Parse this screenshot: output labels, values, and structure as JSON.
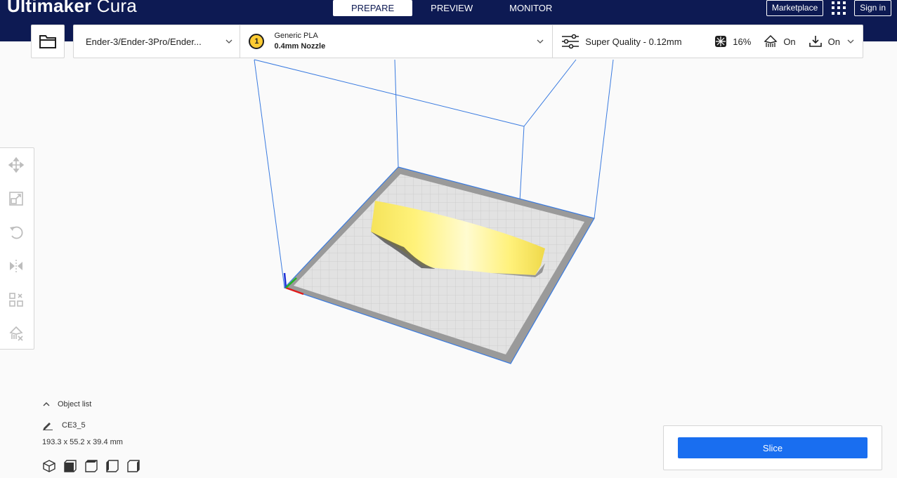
{
  "app": {
    "brand_bold": "Ultimaker",
    "brand_light": "Cura"
  },
  "stages": [
    {
      "label": "PREPARE",
      "active": true
    },
    {
      "label": "PREVIEW",
      "active": false
    },
    {
      "label": "MONITOR",
      "active": false
    }
  ],
  "header": {
    "marketplace": "Marketplace",
    "sign_in": "Sign in"
  },
  "machine": {
    "name": "Ender-3/Ender-3Pro/Ender..."
  },
  "material": {
    "extruder_number": "1",
    "name": "Generic PLA",
    "nozzle": "0.4mm Nozzle",
    "color": "#ffcc33"
  },
  "print_settings": {
    "profile": "Super Quality - 0.12mm",
    "infill": "16%",
    "support": "On",
    "adhesion": "On"
  },
  "tools": [
    {
      "icon": "move-icon"
    },
    {
      "icon": "scale-icon"
    },
    {
      "icon": "rotate-icon"
    },
    {
      "icon": "mirror-icon"
    },
    {
      "icon": "per-model-settings-icon"
    },
    {
      "icon": "support-blocker-icon"
    }
  ],
  "objects": {
    "toggle_label": "Object list",
    "name": "CE3_5",
    "dimensions": "193.3 x 55.2 x 39.4 mm"
  },
  "view_buttons": [
    "3d-view-icon",
    "front-view-icon",
    "top-view-icon",
    "left-view-icon",
    "right-view-icon"
  ],
  "slice": {
    "label": "Slice"
  },
  "colors": {
    "header_bg": "#0d1a53",
    "accent": "#196ef0",
    "volume_line": "#3a7be0",
    "model": "#fff36a"
  }
}
